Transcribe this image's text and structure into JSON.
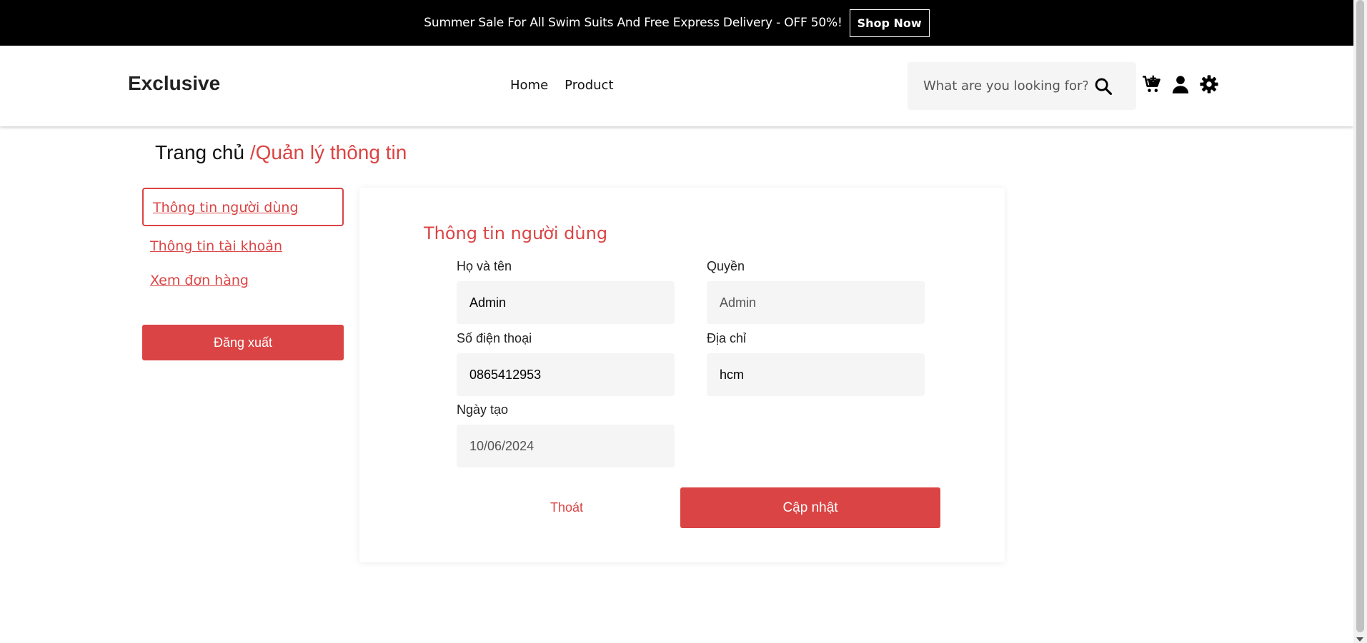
{
  "promo": {
    "text": "Summer Sale For All Swim Suits And Free Express Delivery - OFF 50%!",
    "button_label": "Shop Now"
  },
  "header": {
    "logo": "Exclusive",
    "nav": [
      {
        "label": "Home"
      },
      {
        "label": "Product"
      }
    ],
    "search": {
      "placeholder": "What are you looking for?",
      "icon": "search-icon"
    },
    "icons": [
      "cart-icon",
      "user-icon",
      "gear-icon"
    ]
  },
  "breadcrumb": {
    "home": "Trang chủ",
    "current": "/Quản lý thông tin"
  },
  "sidebar": {
    "items": [
      {
        "label": "Thông tin người dùng",
        "active": true
      },
      {
        "label": "Thông tin tài khoản",
        "active": false
      },
      {
        "label": "Xem đơn hàng",
        "active": false
      }
    ],
    "logout_label": "Đăng xuất"
  },
  "form": {
    "title": "Thông tin người dùng",
    "fields": {
      "name": {
        "label": "Họ và tên",
        "value": "Admin"
      },
      "role": {
        "label": "Quyền",
        "value": "Admin"
      },
      "phone": {
        "label": "Số điện thoại",
        "value": "0865412953"
      },
      "address": {
        "label": "Địa chỉ",
        "value": "hcm"
      },
      "created": {
        "label": "Ngày tạo",
        "value": "10/06/2024"
      }
    },
    "exit_label": "Thoát",
    "update_label": "Cập nhật"
  },
  "colors": {
    "accent": "#db4444",
    "topbar": "#000000",
    "input_bg": "#f5f5f5"
  }
}
